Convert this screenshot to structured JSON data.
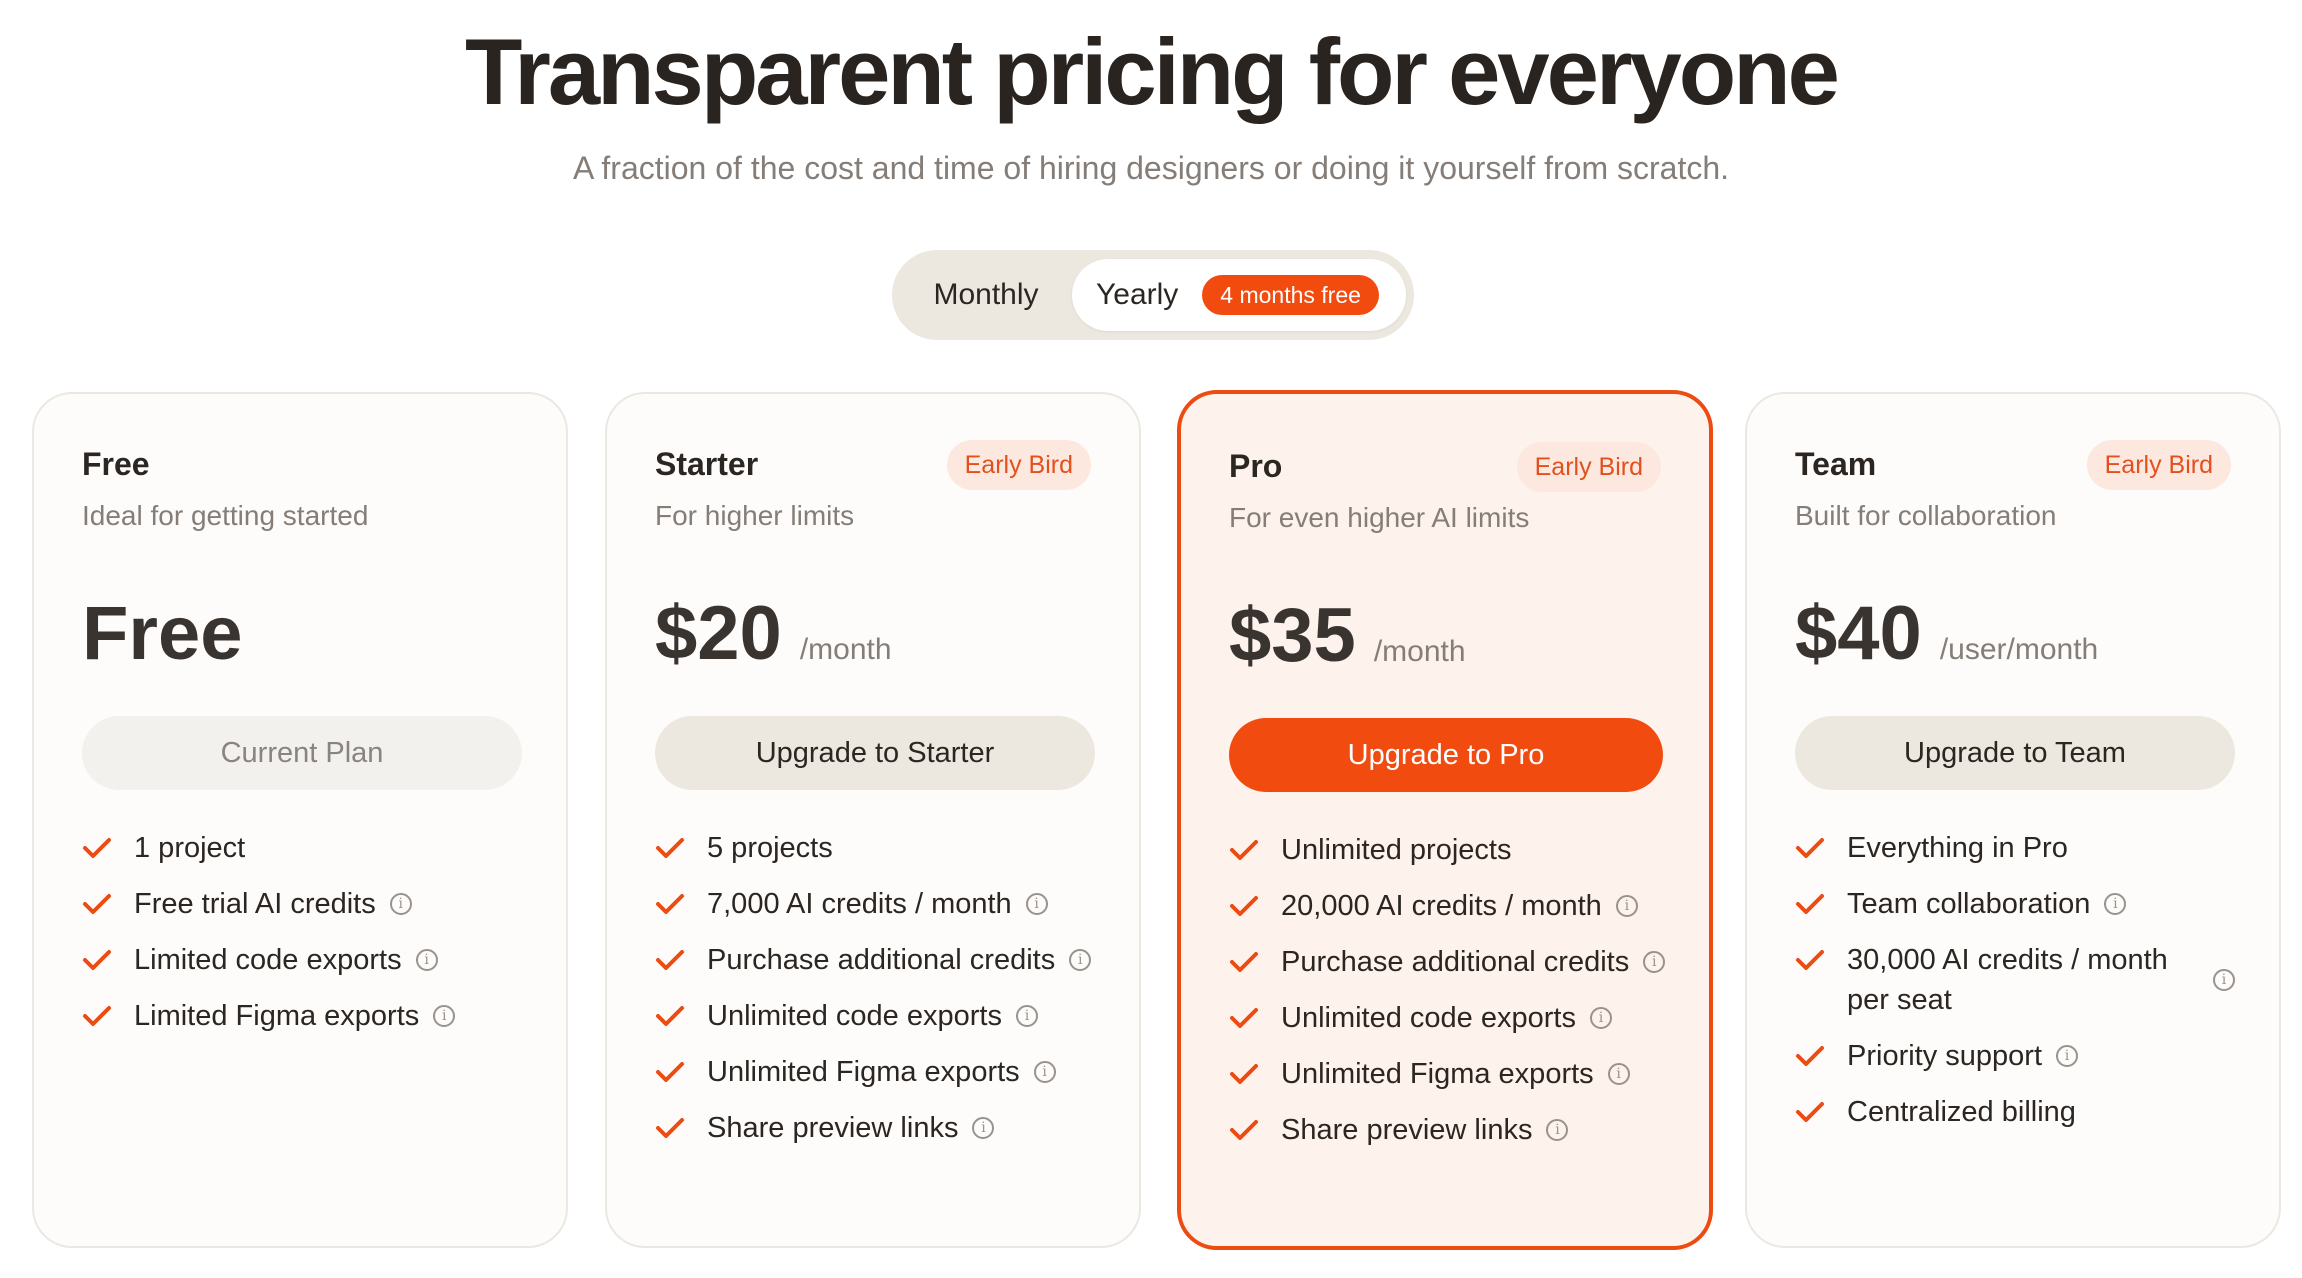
{
  "header": {
    "title": "Transparent pricing for everyone",
    "subtitle": "A fraction of the cost and time of hiring designers or doing it yourself from scratch."
  },
  "billing_toggle": {
    "monthly_label": "Monthly",
    "yearly_label": "Yearly",
    "yearly_badge": "4 months free",
    "selected": "Yearly"
  },
  "colors": {
    "accent": "#f24b0f",
    "check": "#ec4b12"
  },
  "icons": {
    "check": "check-icon",
    "info": "info-icon"
  },
  "plans": [
    {
      "name": "Free",
      "description": "Ideal for getting started",
      "badge": "",
      "price": "Free",
      "period": "",
      "button": "Current Plan",
      "features": [
        {
          "text": "1 project",
          "info": false
        },
        {
          "text": "Free trial AI credits",
          "info": true
        },
        {
          "text": "Limited code exports",
          "info": true
        },
        {
          "text": "Limited Figma exports",
          "info": true
        }
      ]
    },
    {
      "name": "Starter",
      "description": "For higher limits",
      "badge": "Early Bird",
      "price": "$20",
      "period": "/month",
      "button": "Upgrade to Starter",
      "features": [
        {
          "text": "5 projects",
          "info": false
        },
        {
          "text": "7,000 AI credits / month",
          "info": true
        },
        {
          "text": "Purchase additional credits",
          "info": true
        },
        {
          "text": "Unlimited code exports",
          "info": true
        },
        {
          "text": "Unlimited Figma exports",
          "info": true
        },
        {
          "text": "Share preview links",
          "info": true
        }
      ]
    },
    {
      "name": "Pro",
      "description": "For even higher AI limits",
      "badge": "Early Bird",
      "price": "$35",
      "period": "/month",
      "button": "Upgrade to Pro",
      "features": [
        {
          "text": "Unlimited projects",
          "info": false
        },
        {
          "text": "20,000 AI credits / month",
          "info": true
        },
        {
          "text": "Purchase additional credits",
          "info": true
        },
        {
          "text": "Unlimited code exports",
          "info": true
        },
        {
          "text": "Unlimited Figma exports",
          "info": true
        },
        {
          "text": "Share preview links",
          "info": true
        }
      ]
    },
    {
      "name": "Team",
      "description": "Built for collaboration",
      "badge": "Early Bird",
      "price": "$40",
      "period": "/user/month",
      "button": "Upgrade to Team",
      "features": [
        {
          "text": "Everything in Pro",
          "info": false
        },
        {
          "text": "Team collaboration",
          "info": true
        },
        {
          "text": "30,000 AI credits / month per seat",
          "info": true
        },
        {
          "text": "Priority support",
          "info": true
        },
        {
          "text": "Centralized billing",
          "info": false
        }
      ]
    }
  ]
}
